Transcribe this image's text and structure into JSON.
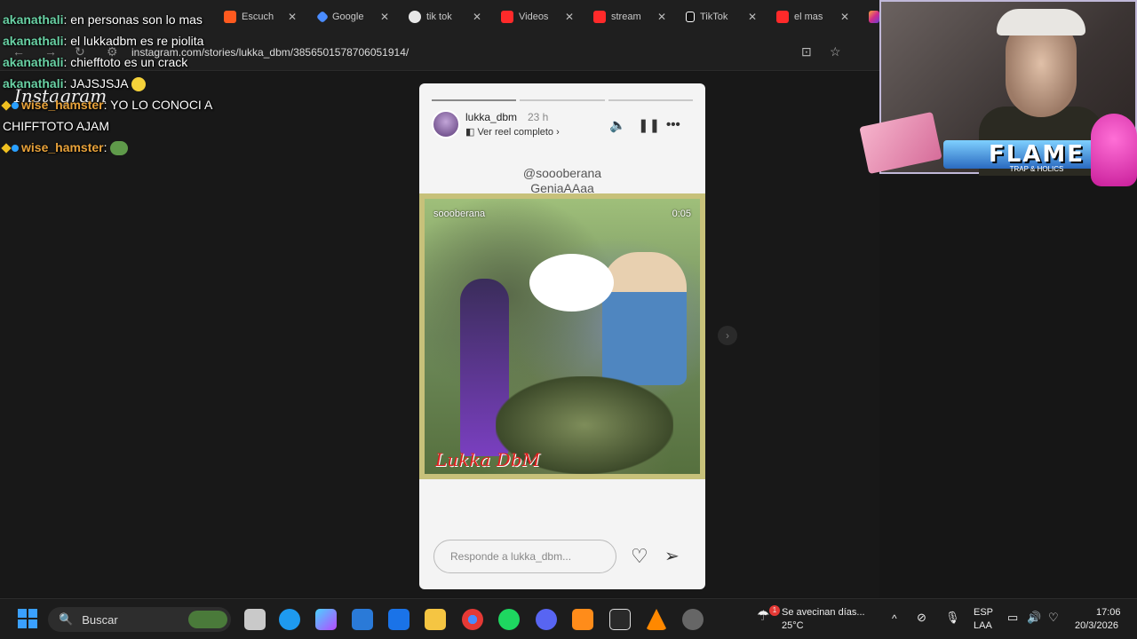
{
  "browser": {
    "tabs": [
      {
        "label": "Escuch",
        "color": "#ff5a1f"
      },
      {
        "label": "Google",
        "color": "#4a8cff"
      },
      {
        "label": "tik tok",
        "color": "#4a8cff"
      },
      {
        "label": "Videos",
        "color": "#ff2a2a"
      },
      {
        "label": "stream",
        "color": "#ff2a2a"
      },
      {
        "label": "TikTok",
        "color": "#ffffff"
      },
      {
        "label": "el mas",
        "color": "#ff2a2a"
      }
    ],
    "url": "instagram.com/stories/lukka_dbm/3856501578706051914/"
  },
  "page": {
    "logo": "Instagram"
  },
  "chat": [
    {
      "user": "akanathali",
      "text": "en personas son lo mas"
    },
    {
      "user": "akanathali",
      "text": "el lukkadbm es re piolita"
    },
    {
      "user": "akanathali",
      "text": "chiefftoto es un crack"
    },
    {
      "user": "akanathali",
      "text": "JAJSJSJA"
    },
    {
      "user": "wise_hamster",
      "text": "YO LO CONOCI A"
    },
    {
      "user": "",
      "text": "CHIFFTOTO AJAM"
    },
    {
      "user": "wise_hamster",
      "text": ""
    }
  ],
  "story": {
    "username": "lukka_dbm",
    "time": "23 h",
    "reel_link": "Ver reel completo",
    "caption_line1": "@sooobera​na",
    "caption_line2": "GeniaAAaa",
    "media_user": "sooobera​na",
    "media_time": "0:05",
    "signature": "Lukka DbM",
    "reply_placeholder": "Responde a lukka_dbm...",
    "progress_segments": 3,
    "progress_done": 1
  },
  "overlay": {
    "flame_title": "FLAME",
    "flame_sub": "TRAP & HOLICS"
  },
  "taskbar": {
    "search_label": "Buscar",
    "weather_text": "Se avecinan días...",
    "temperature": "25°C",
    "weather_badge": "1",
    "language": "ESP",
    "layout": "LAA",
    "time": "17:06",
    "date": "20/3/2026"
  }
}
